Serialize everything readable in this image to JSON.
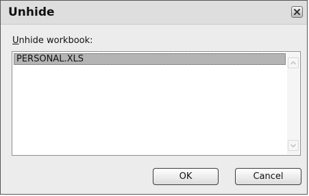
{
  "dialog": {
    "title": "Unhide",
    "close_icon": "close-x-icon"
  },
  "list": {
    "label_mnemonic": "U",
    "label_rest": "nhide workbook:",
    "items": [
      {
        "label": "PERSONAL.XLS",
        "selected": true
      }
    ],
    "scroll_up_icon": "chevron-up-icon",
    "scroll_down_icon": "chevron-down-icon"
  },
  "buttons": {
    "ok_label": "OK",
    "cancel_label": "Cancel"
  }
}
